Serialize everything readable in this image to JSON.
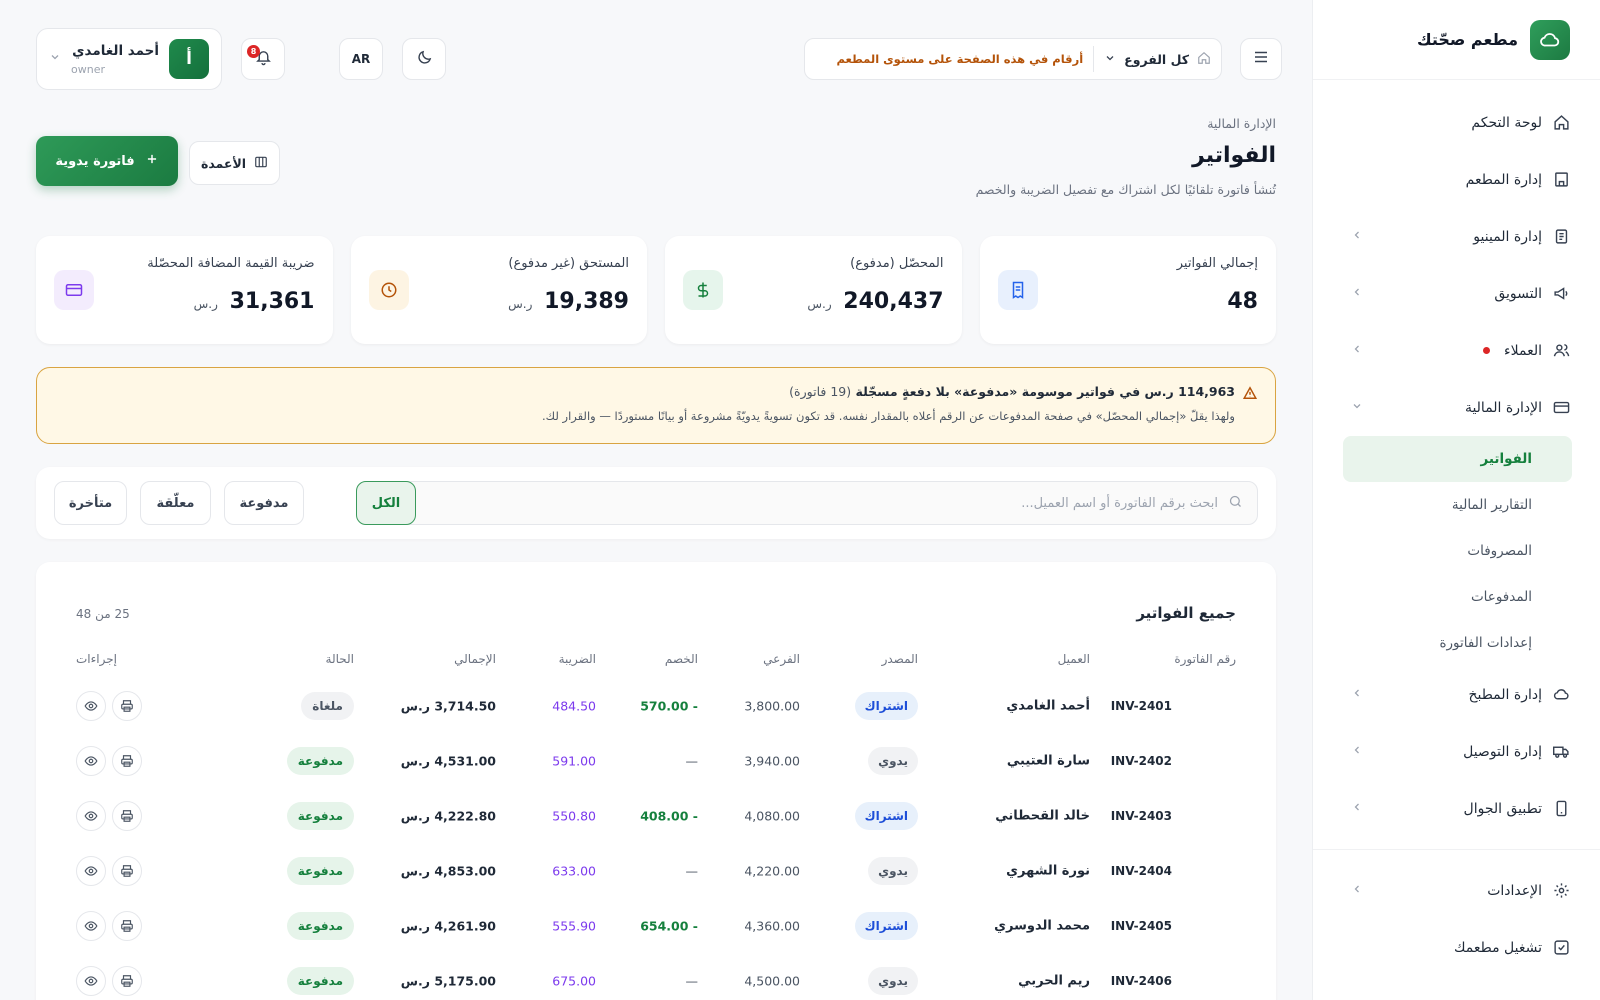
{
  "sidebar": {
    "brand": "مطعم صحّتك",
    "items": [
      {
        "label": "لوحة التحكم"
      },
      {
        "label": "إدارة المطعم"
      },
      {
        "label": "إدارة المينيو"
      },
      {
        "label": "التسويق"
      },
      {
        "label": "العملاء"
      },
      {
        "label": "الإدارة المالية"
      }
    ],
    "sub_items": [
      {
        "label": "الفواتير"
      },
      {
        "label": "التقارير المالية"
      },
      {
        "label": "المصروفات"
      },
      {
        "label": "المدفوعات"
      },
      {
        "label": "إعدادات الفاتورة"
      }
    ],
    "items2": [
      {
        "label": "إدارة المطبخ"
      },
      {
        "label": "إدارة التوصيل"
      },
      {
        "label": "تطبيق الجوال"
      }
    ],
    "settings": "الإعدادات",
    "run": "تشغيل مطعمك"
  },
  "topbar": {
    "branch": "كل الفروع",
    "hint": "أرقام في هذه الصفحة على مستوى المطعم",
    "lang": "AR",
    "notif_count": "8",
    "user_name": "أحمد الغامدي",
    "user_role": "owner",
    "avatar_letter": "أ"
  },
  "header": {
    "breadcrumb": "الإدارة المالية",
    "title": "الفواتير",
    "subtitle": "تُنشأ فاتورة تلقائيًا لكل اشتراك مع تفصيل الضريبة والخصم",
    "new_invoice": "فاتورة يدوية",
    "columns": "الأعمدة"
  },
  "stats": [
    {
      "label": "إجمالي الفواتير",
      "value": "48",
      "unit": ""
    },
    {
      "label": "المحصّل (مدفوع)",
      "value": "240,437",
      "unit": "ر.س"
    },
    {
      "label": "المستحق (غير مدفوع)",
      "value": "19,389",
      "unit": "ر.س"
    },
    {
      "label": "ضريبة القيمة المضافة المحصّلة",
      "value": "31,361",
      "unit": "ر.س"
    }
  ],
  "alert": {
    "line1": "114,963 ر.س في فواتير موسومة «مدفوعة» بلا دفعةٍ مسجّلة",
    "count": "(19 فاتورة)",
    "line2": "ولهذا يقلّ «إجمالي المحصّل» في صفحة المدفوعات عن الرقم أعلاه بالمقدار نفسه. قد تكون تسويةً يدويّةً مشروعة أو بيانًا مستوردًا — والقرار لك."
  },
  "filters": {
    "search_placeholder": "ابحث برقم الفاتورة أو اسم العميل...",
    "chips": [
      "الكل",
      "مدفوعة",
      "معلّقة",
      "متأخرة"
    ]
  },
  "table": {
    "title": "جميع الفواتير",
    "count": "25 من 48",
    "headers": {
      "invoice": "رقم الفاتورة",
      "customer": "العميل",
      "source": "المصدر",
      "subtotal": "الفرعي",
      "discount": "الخصم",
      "tax": "الضريبة",
      "total": "الإجمالي",
      "status": "الحالة",
      "actions": "إجراءات"
    },
    "rows": [
      {
        "inv": "INV-2401",
        "cust": "أحمد الغامدي",
        "src": "اشتراك",
        "sub": "3,800.00",
        "disc": "- 570.00",
        "tax": "484.50",
        "tot": "3,714.50 ر.س",
        "status": "ملغاة"
      },
      {
        "inv": "INV-2402",
        "cust": "سارة العتيبي",
        "src": "يدوي",
        "sub": "3,940.00",
        "disc": "—",
        "tax": "591.00",
        "tot": "4,531.00 ر.س",
        "status": "مدفوعة"
      },
      {
        "inv": "INV-2403",
        "cust": "خالد القحطاني",
        "src": "اشتراك",
        "sub": "4,080.00",
        "disc": "- 408.00",
        "tax": "550.80",
        "tot": "4,222.80 ر.س",
        "status": "مدفوعة"
      },
      {
        "inv": "INV-2404",
        "cust": "نورة الشهري",
        "src": "يدوي",
        "sub": "4,220.00",
        "disc": "—",
        "tax": "633.00",
        "tot": "4,853.00 ر.س",
        "status": "مدفوعة"
      },
      {
        "inv": "INV-2405",
        "cust": "محمد الدوسري",
        "src": "اشتراك",
        "sub": "4,360.00",
        "disc": "- 654.00",
        "tax": "555.90",
        "tot": "4,261.90 ر.س",
        "status": "مدفوعة"
      },
      {
        "inv": "INV-2406",
        "cust": "ريم الحربي",
        "src": "يدوي",
        "sub": "4,500.00",
        "disc": "—",
        "tax": "675.00",
        "tot": "5,175.00 ر.س",
        "status": "مدفوعة"
      }
    ]
  },
  "colors": {
    "brand": "#1d7a42",
    "warning_border": "#d9a441",
    "tax": "#7c3aed",
    "discount": "#15803d"
  }
}
